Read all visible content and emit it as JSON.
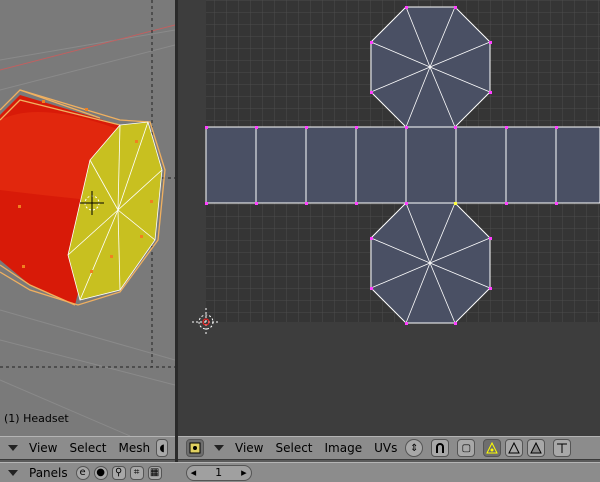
{
  "viewport3d": {
    "object_label": "(1) Headset",
    "menus": [
      "View",
      "Select",
      "Mesh"
    ]
  },
  "uv_editor": {
    "menus": [
      "View",
      "Select",
      "Image",
      "UVs"
    ]
  },
  "buttons_window": {
    "panels_label": "Panels",
    "frame_value": "1"
  },
  "colors": {
    "header_bg": "#8c8c8c",
    "viewport_bg": "#7a7a7a",
    "uv_bg": "#3d3d3d",
    "uv_face": "#4a5064",
    "mesh_red": "#d81a08",
    "mesh_yellow": "#c8c020",
    "wire_orange": "#f0b060"
  },
  "icons": [
    "image-editor-icon",
    "sync-icon",
    "magnet-icon",
    "uv-select-mode-icon",
    "vertex-mode-icon",
    "face-mode-icon",
    "cursor-icon",
    "scene-icon",
    "material-icon",
    "object-icon",
    "edit-icon",
    "render-icon"
  ]
}
